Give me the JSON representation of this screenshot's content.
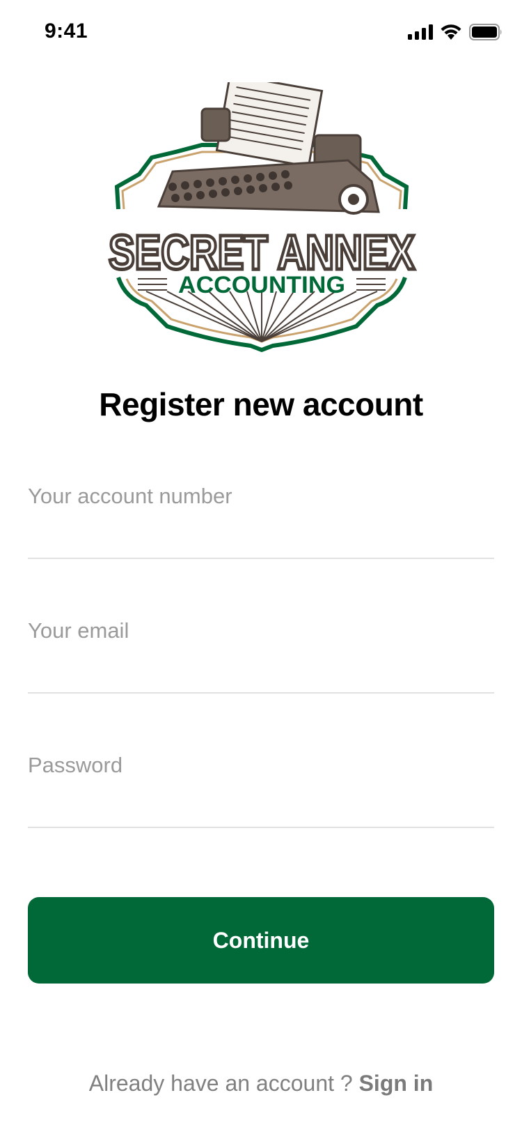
{
  "status_bar": {
    "time": "9:41",
    "icons": [
      "signal-icon",
      "wifi-icon",
      "battery-icon"
    ]
  },
  "logo": {
    "brand_line1": "SECRET ANNEX",
    "brand_line2": "ACCOUNTING",
    "colors": {
      "brown": "#4a3f38",
      "green": "#006937",
      "gold": "#c9a26d"
    }
  },
  "page": {
    "title": "Register new account"
  },
  "form": {
    "account_number": {
      "placeholder": "Your account number",
      "value": ""
    },
    "email": {
      "placeholder": "Your email",
      "value": ""
    },
    "password": {
      "placeholder": "Password",
      "value": ""
    }
  },
  "actions": {
    "continue_label": "Continue",
    "signin_prompt": "Already have an account ? ",
    "signin_link": "Sign in"
  },
  "colors": {
    "accent": "#006937",
    "placeholder": "#9a9a9a",
    "divider": "#e1e1e1"
  }
}
